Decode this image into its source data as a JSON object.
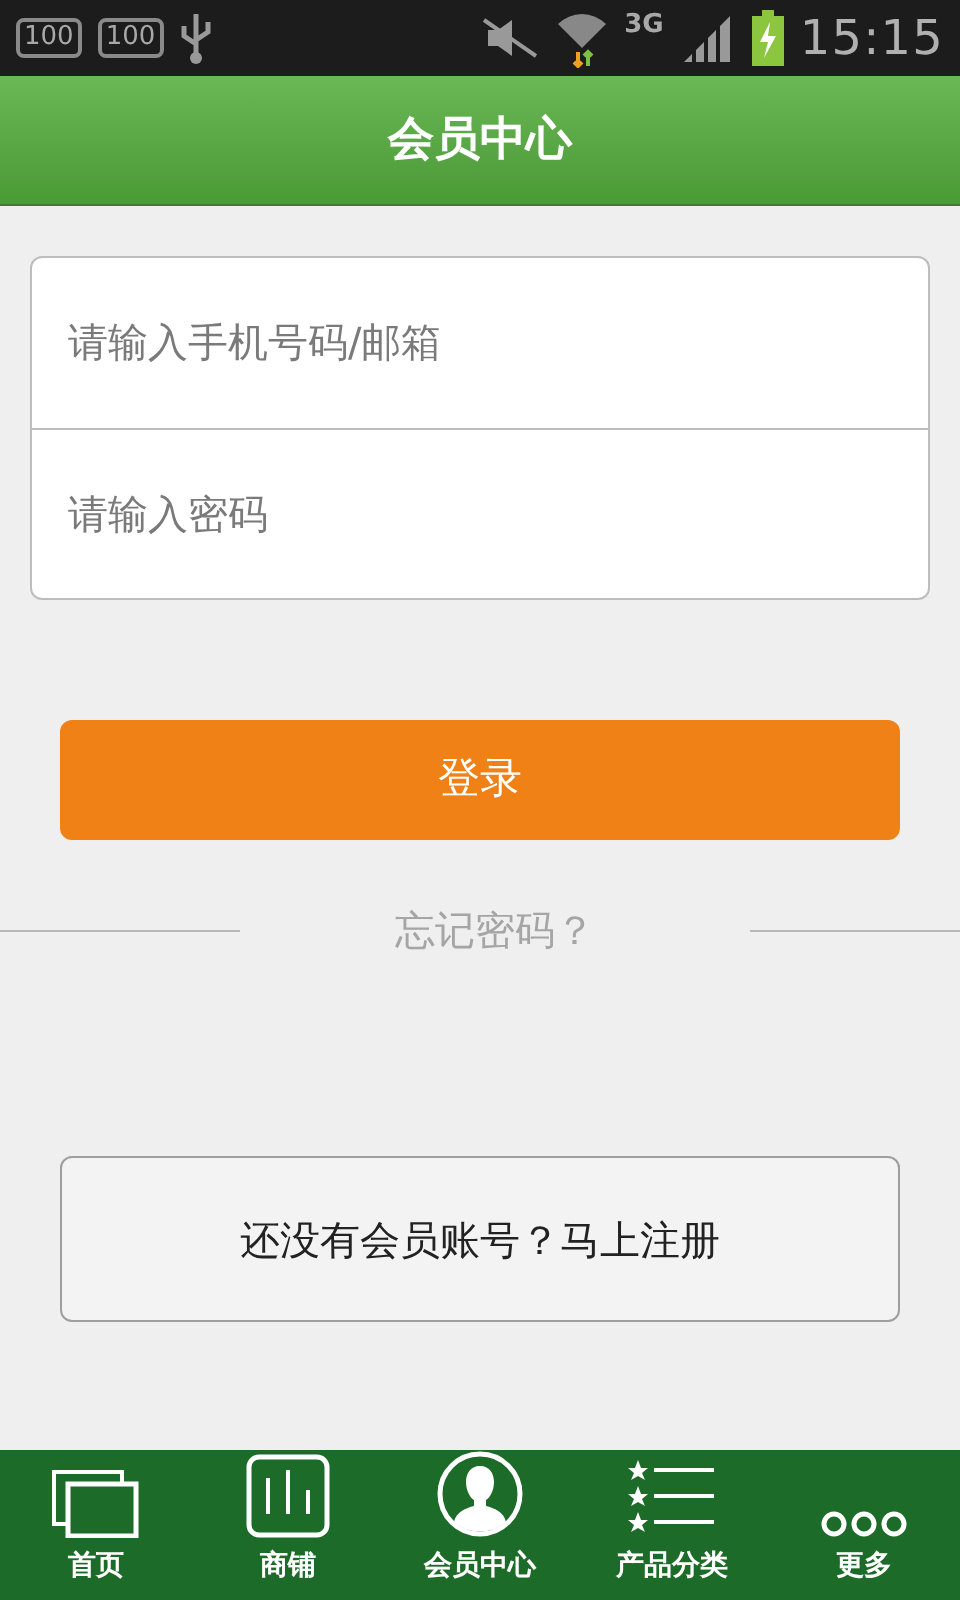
{
  "status_bar": {
    "battery_badges": [
      "100",
      "100"
    ],
    "network": "3G",
    "time": "15:15"
  },
  "header": {
    "title": "会员中心"
  },
  "login_form": {
    "fields": [
      {
        "placeholder": "请输入手机号码/邮箱"
      },
      {
        "placeholder": "请输入密码"
      }
    ],
    "login_button": "登录",
    "forgot_password": "忘记密码？"
  },
  "register_button": "还没有会员账号？马上注册",
  "bottom_nav": [
    {
      "label": "首页",
      "kind": "windows"
    },
    {
      "label": "商铺",
      "kind": "chart"
    },
    {
      "label": "会员中心",
      "kind": "person"
    },
    {
      "label": "产品分类",
      "kind": "list"
    },
    {
      "label": "更多",
      "kind": "more"
    }
  ]
}
